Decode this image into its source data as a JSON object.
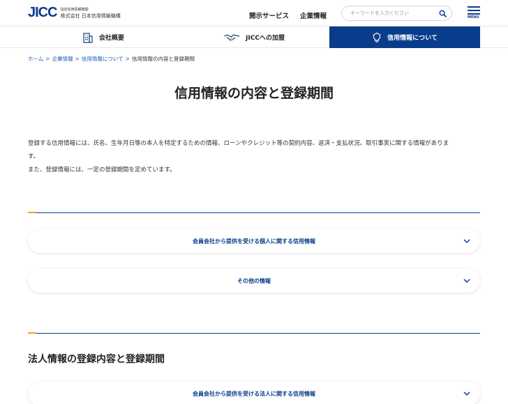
{
  "header": {
    "logo_mark": "JICC",
    "logo_small": "指定信用情報機関",
    "logo_name": "株式会社 日本信用情報機構",
    "nav": [
      {
        "label": "開示サービス",
        "active": false
      },
      {
        "label": "企業情報",
        "active": true
      }
    ],
    "search_placeholder": "キーワードを入力ください",
    "search_icon": "search-icon",
    "menu_label": "MENU"
  },
  "subnav": [
    {
      "label": "会社概要",
      "icon": "building-icon"
    },
    {
      "label": "JICCへの加盟",
      "icon": "handshake-icon"
    },
    {
      "label": "信用情報について",
      "icon": "lightbulb-icon",
      "active": true
    }
  ],
  "breadcrumb": {
    "items": [
      "ホーム",
      "企業情報",
      "信用情報について"
    ],
    "current": "信用情報の内容と登録期間",
    "separator": ">"
  },
  "page": {
    "title": "信用情報の内容と登録期間",
    "intro_1": "登録する信用情報には、氏名、生年月日等の本人を特定するための情報、ローンやクレジット等の契約内容、返済・支払状況、取引事実に関する情報がありま",
    "intro_1b": "す。",
    "intro_2": "また、登録情報には、一定の登録期間を定めています。"
  },
  "accordions": [
    {
      "label": "会員会社から提供を受ける個人に関する信用情報"
    },
    {
      "label": "その他の情報"
    },
    {
      "label": "会員会社から提供を受ける法人に関する信用情報"
    }
  ],
  "section2": {
    "title": "法人情報の登録内容と登録期間"
  },
  "colors": {
    "brand": "#0a3c8c",
    "accent": "#f0a020",
    "link": "#1a5bb5"
  }
}
